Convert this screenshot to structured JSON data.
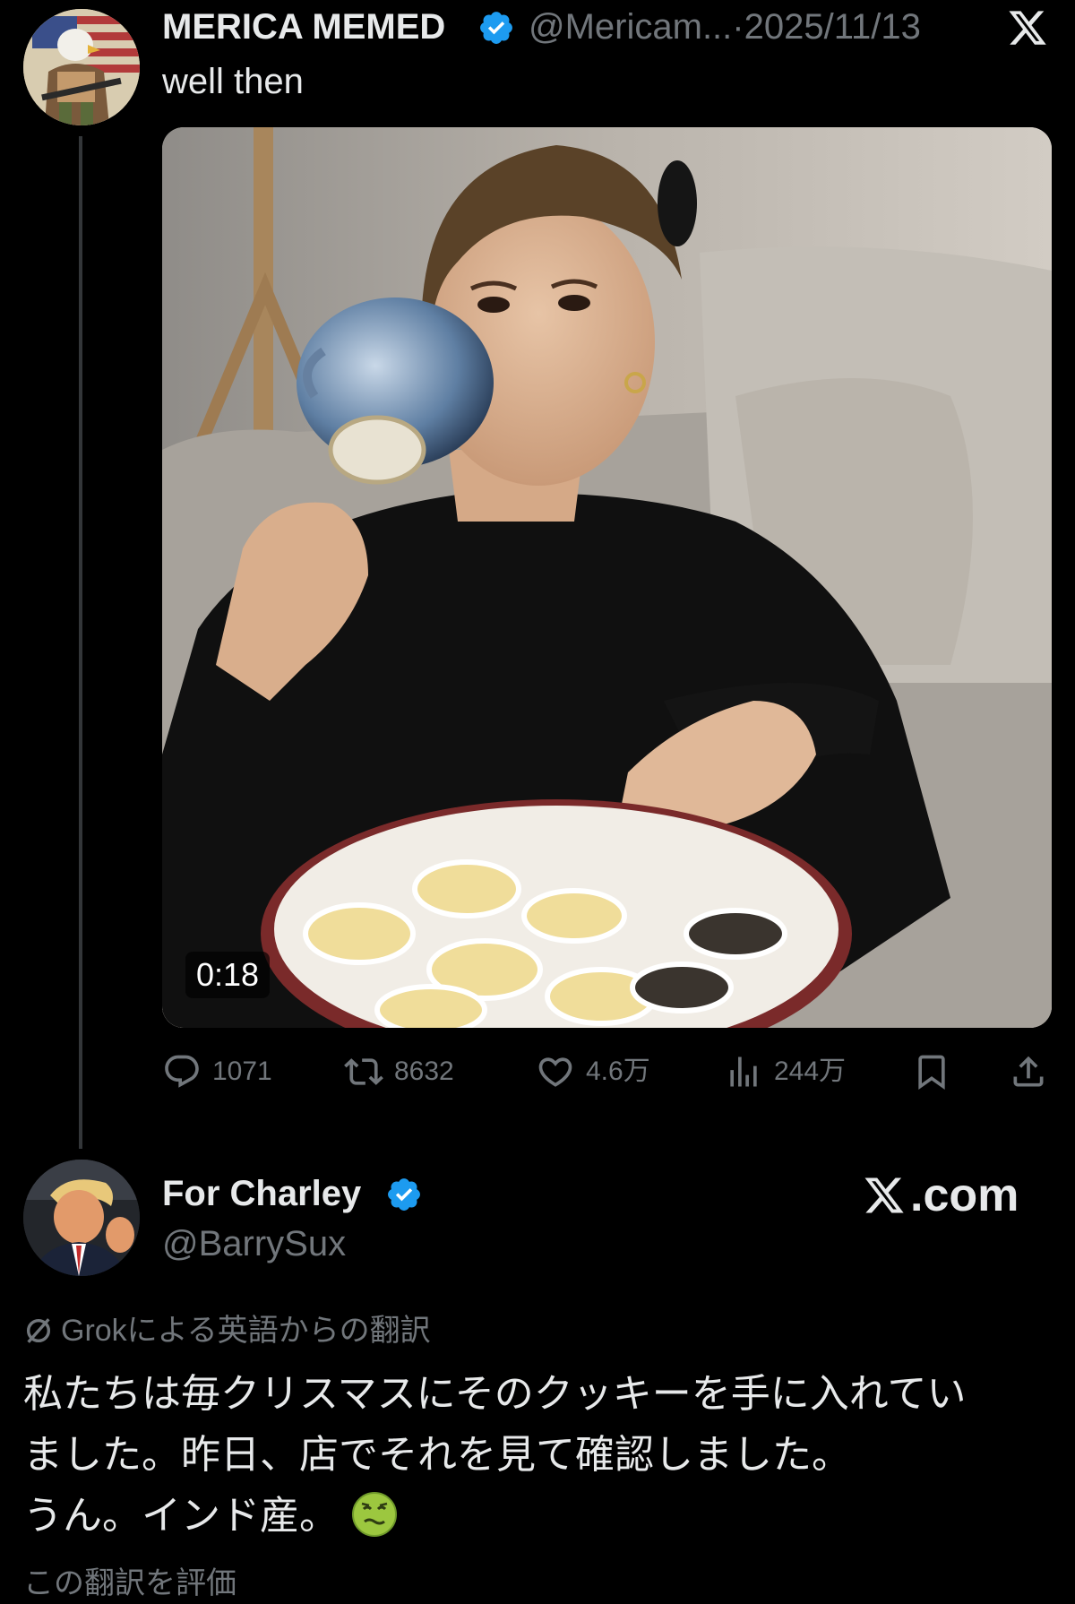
{
  "tweet": {
    "author": {
      "display_name": "MERICA MEMED",
      "verified": true,
      "handle": "@Mericam...",
      "separator": "·",
      "date": "2025/11/13"
    },
    "platform_icon": "x-logo-icon",
    "text": "well then",
    "media": {
      "type": "video",
      "duration": "0:18"
    },
    "actions": {
      "replies": "1071",
      "reposts": "8632",
      "likes": "4.6万",
      "views": "244万"
    }
  },
  "quoted": {
    "author": {
      "display_name": "For Charley",
      "verified": true,
      "handle": "@BarrySux"
    },
    "site_label": ".com",
    "translation_note": "Grokによる英語からの翻訳",
    "body_lines": [
      "私たちは毎クリスマスにそのクッキーを手に入れてい",
      "ました。昨日、店でそれを見て確認しました。",
      "うん。インド産。"
    ],
    "emoji": "nauseated-face-emoji",
    "rate_translation": "この翻訳を評価"
  },
  "colors": {
    "background": "#000000",
    "text_primary": "#e7e9ea",
    "text_secondary": "#71767b",
    "verified_blue": "#1d9bf0",
    "thread_line": "#333639"
  }
}
